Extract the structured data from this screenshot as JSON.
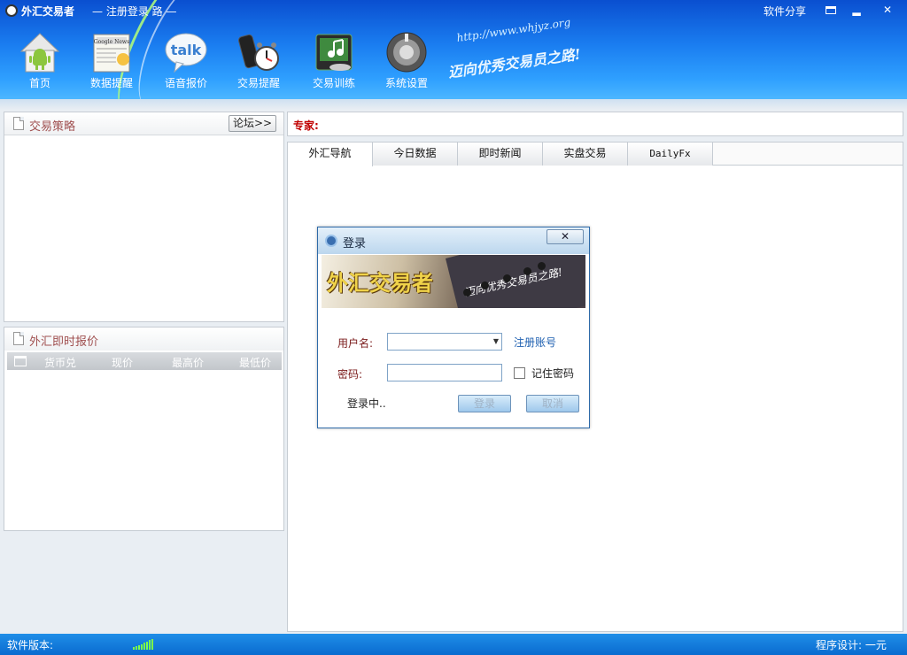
{
  "app": {
    "title": "外汇交易者",
    "subtitle": "— 注册登录 路 —",
    "share_label": "软件分享",
    "minimize_label": "▂",
    "close_label": "✕"
  },
  "nav": {
    "items": [
      {
        "label": "首页",
        "icon": "android-home-icon"
      },
      {
        "label": "数据提醒",
        "icon": "newspaper-icon"
      },
      {
        "label": "语音报价",
        "icon": "talk-bubble-icon"
      },
      {
        "label": "交易提醒",
        "icon": "phone-alarm-clock-icon"
      },
      {
        "label": "交易训练",
        "icon": "music-training-icon"
      },
      {
        "label": "系统设置",
        "icon": "settings-knob-icon"
      }
    ],
    "talk_text": "talk",
    "newspaper_text": "Google News"
  },
  "slogan": {
    "url": "http://www.whjyz.org",
    "text": "迈向优秀交易员之路!"
  },
  "strategy_panel": {
    "title": "交易策略",
    "forum_button": "论坛>>"
  },
  "quote_panel": {
    "title": "外汇即时报价",
    "columns": [
      "货币兑",
      "现价",
      "最高价",
      "最低价"
    ]
  },
  "expert": {
    "label": "专家:"
  },
  "tabs": [
    {
      "label": "外汇导航",
      "active": true
    },
    {
      "label": "今日数据",
      "active": false
    },
    {
      "label": "即时新闻",
      "active": false
    },
    {
      "label": "实盘交易",
      "active": false
    },
    {
      "label": "DailyFx",
      "active": false
    }
  ],
  "login": {
    "title": "登录",
    "close_label": "✕",
    "banner_brand": "外汇交易者",
    "banner_motto": "迈向优秀交易员之路!",
    "username_label": "用户名:",
    "username_value": "",
    "password_label": "密码:",
    "password_value": "",
    "register_link": "注册账号",
    "remember_label": "记住密码",
    "remember_checked": false,
    "status": "登录中..",
    "login_button": "登录",
    "cancel_button": "取消"
  },
  "statusbar": {
    "version_label": "软件版本:",
    "author": "程序设计: 一元"
  },
  "colors": {
    "banner_blue": "#1a7df0",
    "statusbar_blue": "#0a6bd0",
    "expert_red": "#c00000",
    "signal_green": "#7cff4a"
  }
}
